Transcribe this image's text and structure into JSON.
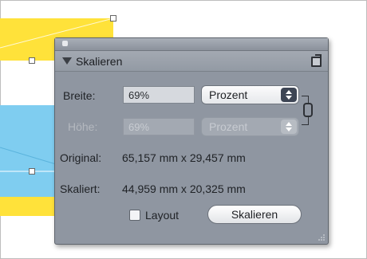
{
  "panel": {
    "title": "Skalieren",
    "width_label": "Breite:",
    "width_value": "69%",
    "width_unit": "Prozent",
    "height_label": "Höhe:",
    "height_value": "69%",
    "height_unit": "Prozent",
    "original_label": "Original:",
    "original_value": "65,157 mm x 29,457 mm",
    "scaled_label": "Skaliert:",
    "scaled_value": "44,959 mm x 20,325 mm",
    "layout_label": "Layout",
    "scale_button": "Skalieren"
  },
  "colors": {
    "shape_yellow": "#ffe23a",
    "shape_blue": "#7fcdf0",
    "panel_bg": "#8f96a1"
  },
  "icons": [
    "collapse-triangle-icon",
    "panel-menu-icon",
    "stepper-arrows-icon",
    "chain-link-icon",
    "resize-grip-icon"
  ]
}
